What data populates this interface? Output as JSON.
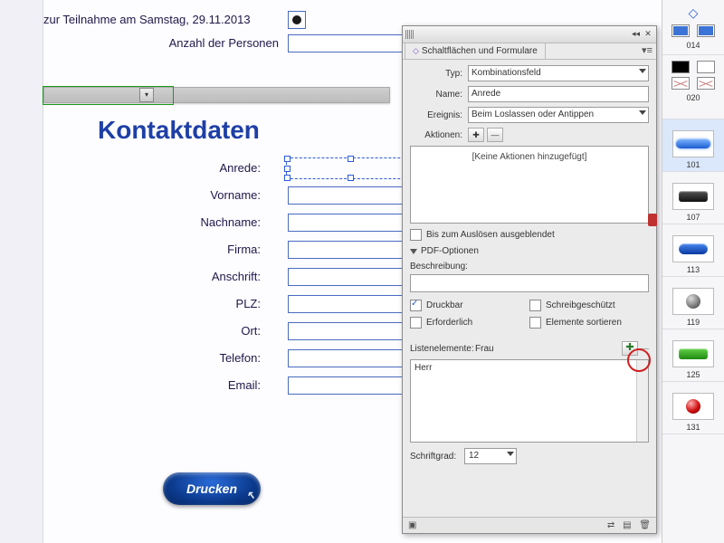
{
  "form": {
    "participation_label": "zur Teilnahme am Samstag, 29.11.2013",
    "persons_label": "Anzahl der Personen",
    "section_title": "Kontaktdaten",
    "fields": {
      "anrede": "Anrede:",
      "vorname": "Vorname:",
      "nachname": "Nachname:",
      "firma": "Firma:",
      "anschrift": "Anschrift:",
      "plz": "PLZ:",
      "ort": "Ort:",
      "telefon": "Telefon:",
      "email": "Email:"
    },
    "print_button": "Drucken"
  },
  "panel": {
    "title": "Schaltflächen und Formulare",
    "rows": {
      "typ_label": "Typ:",
      "typ_value": "Kombinationsfeld",
      "name_label": "Name:",
      "name_value": "Anrede",
      "ereignis_label": "Ereignis:",
      "ereignis_value": "Beim Loslassen oder Antippen",
      "aktionen_label": "Aktionen:",
      "no_actions": "[Keine Aktionen hinzugefügt]",
      "hidden_until": "Bis zum Auslösen ausgeblendet",
      "pdf_options": "PDF-Optionen",
      "beschreibung": "Beschreibung:",
      "druckbar": "Druckbar",
      "schreibgeschuetzt": "Schreibgeschützt",
      "erforderlich": "Erforderlich",
      "sortieren": "Elemente sortieren",
      "listenelemente": "Listenelemente:",
      "list_input": "Frau",
      "list_item1": "Herr",
      "schriftgrad": "Schriftgrad:",
      "schriftgrad_value": "12"
    }
  },
  "rail": {
    "n014": "014",
    "n020": "020",
    "n101": "101",
    "n107": "107",
    "n113": "113",
    "n119": "119",
    "n125": "125",
    "n131": "131"
  }
}
